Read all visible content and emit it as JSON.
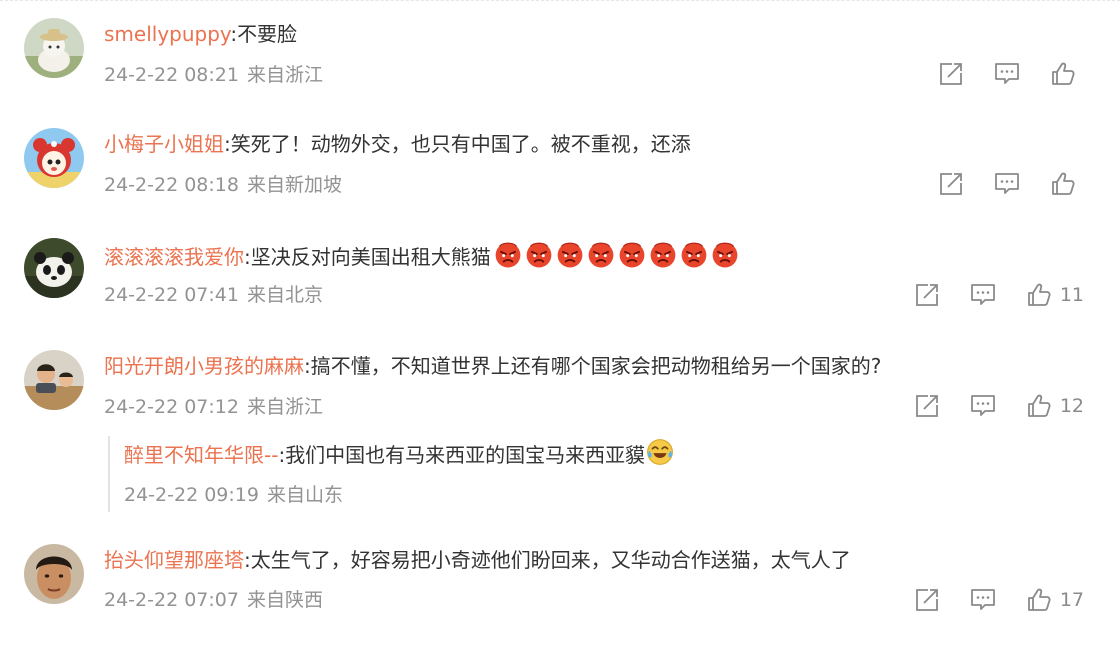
{
  "comments": [
    {
      "username": "smellypuppy",
      "text": "不要脸",
      "time": "24-2-22 08:21",
      "location": "来自浙江",
      "likes": ""
    },
    {
      "username": "小梅子小姐姐",
      "text": "笑死了！动物外交，也只有中国了。被不重视，还添",
      "time": "24-2-22 08:18",
      "location": "来自新加坡",
      "likes": ""
    },
    {
      "username": "滚滚滚滚我爱你",
      "text": "坚决反对向美国出租大熊猫",
      "emoji": "angry-face",
      "emoji_count": 8,
      "time": "24-2-22 07:41",
      "location": "来自北京",
      "likes": "11"
    },
    {
      "username": "阳光开朗小男孩的麻麻",
      "text": "搞不懂，不知道世界上还有哪个国家会把动物租给另一个国家的?",
      "time": "24-2-22 07:12",
      "location": "来自浙江",
      "likes": "12",
      "reply": {
        "username": "醉里不知年华限--",
        "text": "我们中国也有马来西亚的国宝马来西亚貘",
        "emoji": "laugh-cry-face",
        "time": "24-2-22 09:19",
        "location": "来自山东"
      }
    },
    {
      "username": "抬头仰望那座塔",
      "text": "太生气了，好容易把小奇迹他们盼回来，又华动合作送猫，太气人了",
      "time": "24-2-22 07:07",
      "location": "来自陕西",
      "likes": "17"
    }
  ],
  "icons": {
    "share": "share-icon",
    "comment": "comment-icon",
    "like": "thumbs-up-icon"
  },
  "colors": {
    "username": "#eb7350",
    "meta": "#939393",
    "icon": "#8a8a8a"
  }
}
